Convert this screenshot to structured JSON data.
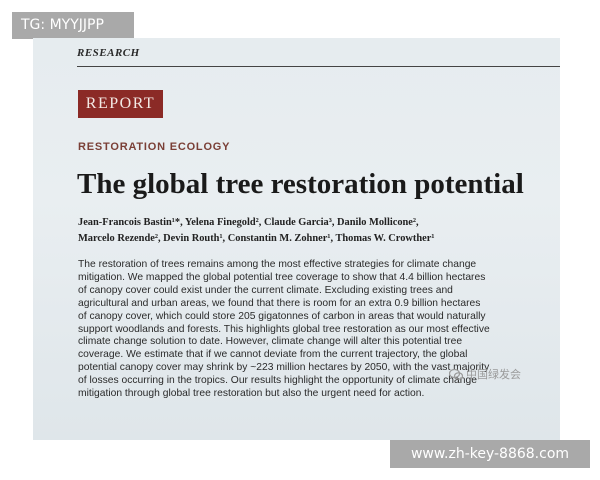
{
  "watermarks": {
    "tg": "TG: MYYJJPP",
    "wechat": "中国绿发会",
    "url": "www.zh-key-8868.com",
    "wechat_icon": "wechat-icon"
  },
  "article": {
    "section": "RESEARCH",
    "report_label": "REPORT",
    "category": "RESTORATION ECOLOGY",
    "title": "The global tree restoration potential",
    "authors_line1": "Jean-Francois Bastin¹*, Yelena Finegold², Claude Garcia³, Danilo Mollicone²,",
    "authors_line2": "Marcelo Rezende², Devin Routh¹, Constantin M. Zohner¹, Thomas W. Crowther¹",
    "abstract_lines": [
      "The restoration of trees remains among the most effective strategies for climate change",
      "mitigation. We mapped the global potential tree coverage to show that 4.4 billion hectares",
      "of canopy cover could exist under the current climate. Excluding existing trees and",
      "agricultural and urban areas, we found that there is room for an extra 0.9 billion hectares",
      "of canopy cover, which could store 205 gigatonnes of carbon in areas that would naturally",
      "support woodlands and forests. This highlights global tree restoration as our most effective",
      "climate change solution to date. However, climate change will alter this potential tree",
      "coverage. We estimate that if we cannot deviate from the current trajectory, the global",
      "potential canopy cover may shrink by ~223 million hectares by 2050, with the vast majority",
      "of losses occurring in the tropics. Our results highlight the opportunity of climate change",
      "mitigation through global tree restoration but also the urgent need for action."
    ]
  },
  "colors": {
    "report_box": "#8b2a26",
    "category_text": "#7a3f36",
    "paper": "#e6ecef",
    "badge": "#a9a9a9"
  }
}
